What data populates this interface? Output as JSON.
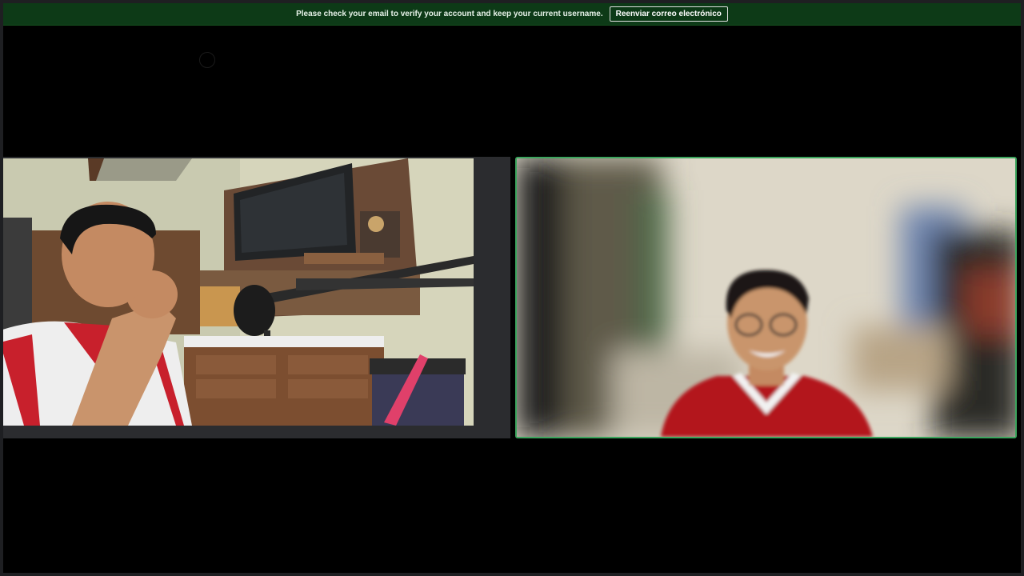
{
  "banner": {
    "message": "Please check your email to verify your account and keep your current username.",
    "resend_label": "Reenviar correo electrónico"
  },
  "colors": {
    "banner_bg": "#0d3a17",
    "speaking_border": "#3ba55d",
    "background": "#000000"
  }
}
